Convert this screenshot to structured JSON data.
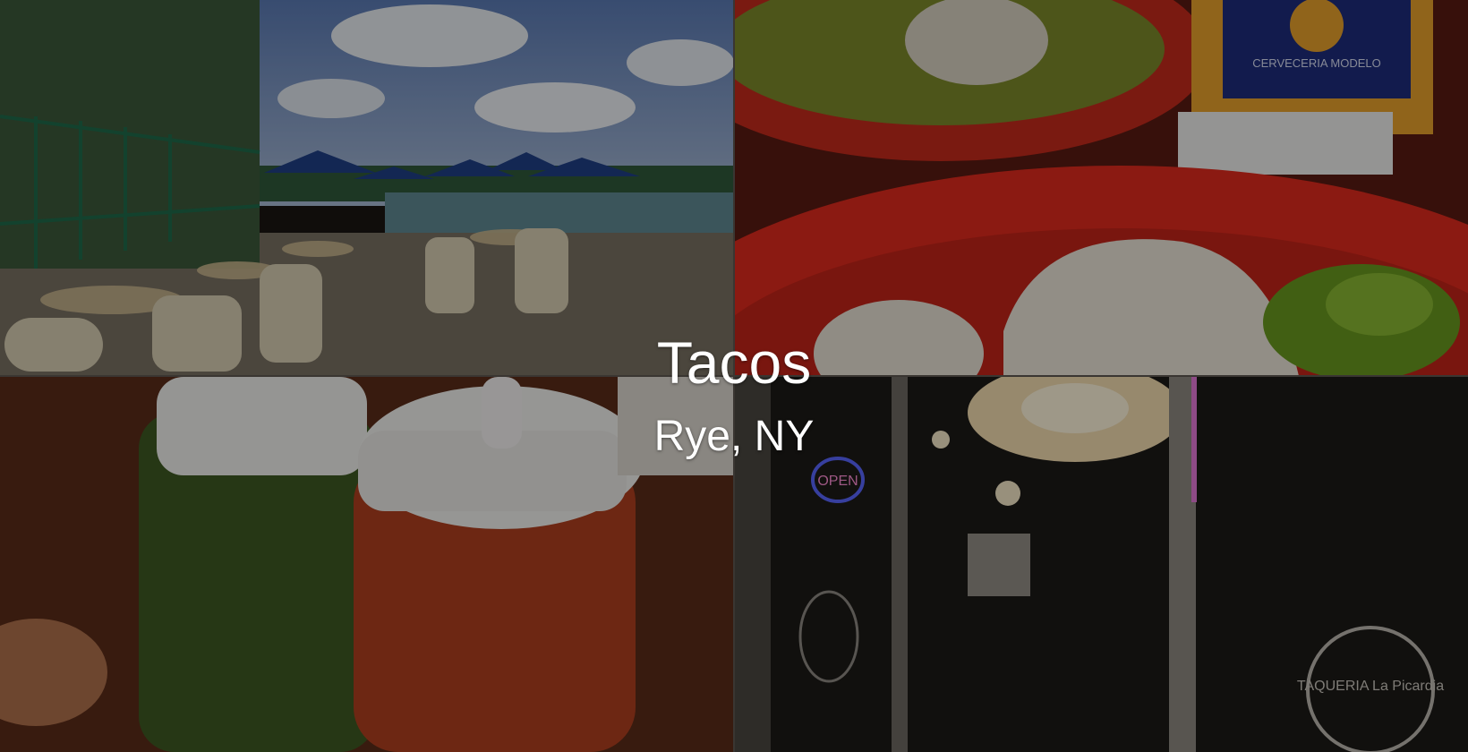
{
  "title": "Tacos",
  "location": "Rye, NY",
  "photos": [
    {
      "name": "outdoor-patio-photo"
    },
    {
      "name": "food-plate-photo"
    },
    {
      "name": "sauce-bottles-photo"
    },
    {
      "name": "storefront-night-photo"
    }
  ],
  "photo_text": {
    "bottle_label": "CERVECERIA MODELO",
    "neon_sign": "OPEN",
    "window_text": "TAQUERIA La Picardia"
  },
  "colors": {
    "overlay": "rgba(0,0,0,0.38)",
    "caption": "#ffffff"
  }
}
